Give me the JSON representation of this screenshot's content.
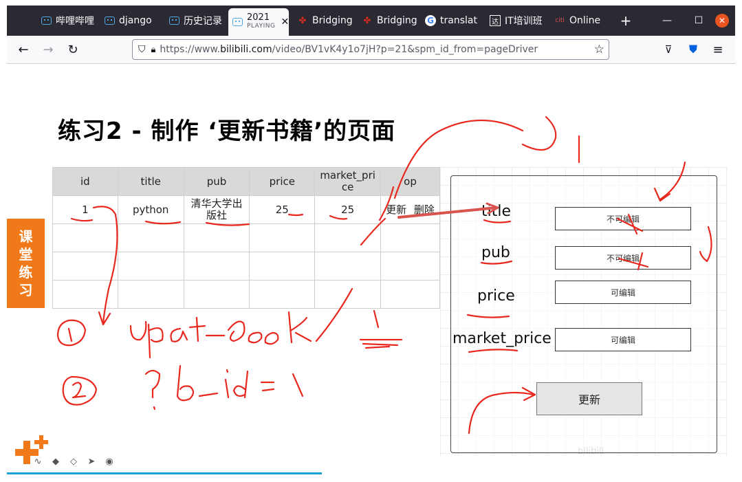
{
  "browser": {
    "tabs": [
      {
        "label": "哔哩哔哩",
        "icon": "bilibili-icon"
      },
      {
        "label": "django",
        "icon": "bilibili-icon"
      },
      {
        "label": "历史记录",
        "icon": "bilibili-icon"
      },
      {
        "label": "2021",
        "sublabel": "PLAYING",
        "icon": "bilibili-icon",
        "active": true
      },
      {
        "label": "Bridging",
        "icon": "maple-leaf-icon"
      },
      {
        "label": "Bridging",
        "icon": "maple-leaf-icon"
      },
      {
        "label": "translat",
        "icon": "google-icon"
      },
      {
        "label": "IT培训班",
        "icon": "da-icon"
      },
      {
        "label": "Online",
        "icon": "citi-icon"
      }
    ],
    "new_tab": "+",
    "url_prefix": "https://www.",
    "url_domain": "bilibili.com",
    "url_path": "/video/BV1vK4y1o7jH?p=21&spm_id_from=pageDriver"
  },
  "slide": {
    "title": "练习2 - 制作 ‘更新书籍’的页面",
    "side_label": [
      "课",
      "堂",
      "练",
      "习"
    ],
    "table": {
      "headers": [
        "id",
        "title",
        "pub",
        "price",
        "market_price",
        "op"
      ],
      "rows": [
        {
          "id": "1",
          "title": "python",
          "pub": "清华大学出版社",
          "price": "25",
          "market_price": "25",
          "op_update": "更新",
          "op_delete": "删除"
        }
      ]
    },
    "form": {
      "fields": [
        {
          "label": "title",
          "value": "不可编辑"
        },
        {
          "label": "pub",
          "value": "不可编辑"
        },
        {
          "label": "price",
          "value": "可编辑"
        },
        {
          "label": "market_price",
          "value": "可编辑"
        }
      ],
      "submit_label": "更新"
    }
  }
}
